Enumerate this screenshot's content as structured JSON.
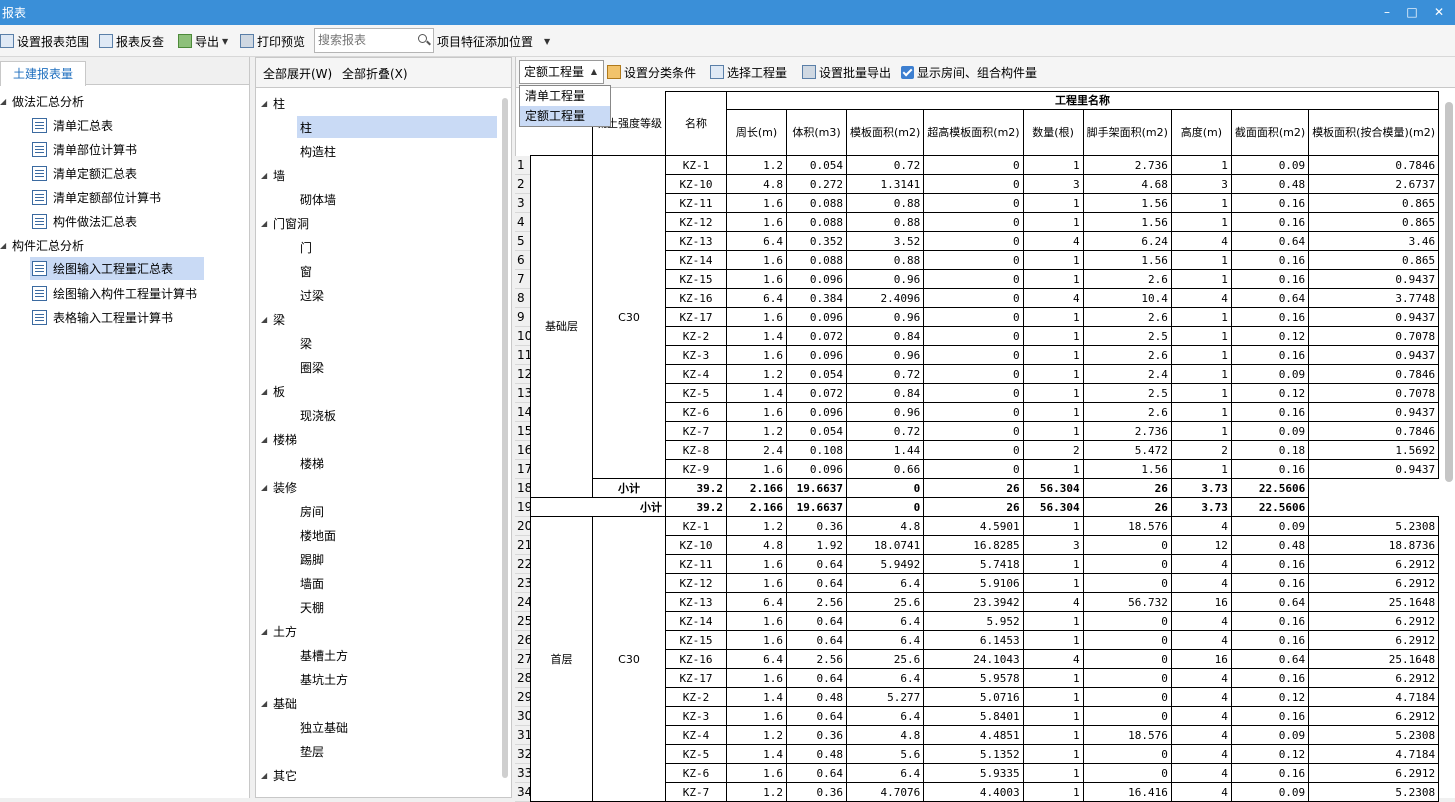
{
  "window": {
    "title": "报表",
    "min": "–",
    "max": "□",
    "close": "✕"
  },
  "toolbar": {
    "set_range": "设置报表范围",
    "reverse": "报表反查",
    "export": "导出",
    "print": "打印预览",
    "search_placeholder": "搜索报表",
    "feature": "项目特征添加位置"
  },
  "left": {
    "tab": "土建报表量",
    "groups": [
      {
        "label": "做法汇总分析",
        "items": [
          "清单汇总表",
          "清单部位计算书",
          "清单定额汇总表",
          "清单定额部位计算书",
          "构件做法汇总表"
        ]
      },
      {
        "label": "构件汇总分析",
        "items": [
          "绘图输入工程量汇总表",
          "绘图输入构件工程量计算书",
          "表格输入工程量计算书"
        ]
      }
    ]
  },
  "mid": {
    "expand": "全部展开(W)",
    "collapse": "全部折叠(X)",
    "tree": [
      {
        "label": "柱",
        "items": [
          "柱",
          "构造柱"
        ]
      },
      {
        "label": "墙",
        "items": [
          "砌体墙"
        ]
      },
      {
        "label": "门窗洞",
        "items": [
          "门",
          "窗",
          "过梁"
        ]
      },
      {
        "label": "梁",
        "items": [
          "梁",
          "圈梁"
        ]
      },
      {
        "label": "板",
        "items": [
          "现浇板"
        ]
      },
      {
        "label": "楼梯",
        "items": [
          "楼梯"
        ]
      },
      {
        "label": "装修",
        "items": [
          "房间",
          "楼地面",
          "踢脚",
          "墙面",
          "天棚"
        ]
      },
      {
        "label": "土方",
        "items": [
          "基槽土方",
          "基坑土方"
        ]
      },
      {
        "label": "基础",
        "items": [
          "独立基础",
          "垫层"
        ]
      },
      {
        "label": "其它",
        "items": []
      }
    ]
  },
  "right": {
    "combo": "定额工程量",
    "opt1": "清单工程量",
    "opt2": "定额工程量",
    "set_cond": "设置分类条件",
    "sel_qty": "选择工程量",
    "batch": "设置批量导出",
    "show": "显示房间、组合构件量"
  },
  "table": {
    "group_header": "工程里名称",
    "h_grade": "凝土强度等级",
    "h_name": "名称",
    "cols": [
      "周长(m)",
      "体积(m3)",
      "模板面积(m2)",
      "超高模板面积(m2)",
      "数量(根)",
      "脚手架面积(m2)",
      "高度(m)",
      "截面面积(m2)",
      "模板面积(按合模量)(m2)"
    ],
    "floor1": "基础层",
    "floor2": "首层",
    "grade": "C30",
    "subtotal": "小计",
    "rows": [
      [
        "KZ-1",
        "1.2",
        "0.054",
        "0.72",
        "0",
        "1",
        "2.736",
        "1",
        "0.09",
        "0.7846"
      ],
      [
        "KZ-10",
        "4.8",
        "0.272",
        "1.3141",
        "0",
        "3",
        "4.68",
        "3",
        "0.48",
        "2.6737"
      ],
      [
        "KZ-11",
        "1.6",
        "0.088",
        "0.88",
        "0",
        "1",
        "1.56",
        "1",
        "0.16",
        "0.865"
      ],
      [
        "KZ-12",
        "1.6",
        "0.088",
        "0.88",
        "0",
        "1",
        "1.56",
        "1",
        "0.16",
        "0.865"
      ],
      [
        "KZ-13",
        "6.4",
        "0.352",
        "3.52",
        "0",
        "4",
        "6.24",
        "4",
        "0.64",
        "3.46"
      ],
      [
        "KZ-14",
        "1.6",
        "0.088",
        "0.88",
        "0",
        "1",
        "1.56",
        "1",
        "0.16",
        "0.865"
      ],
      [
        "KZ-15",
        "1.6",
        "0.096",
        "0.96",
        "0",
        "1",
        "2.6",
        "1",
        "0.16",
        "0.9437"
      ],
      [
        "KZ-16",
        "6.4",
        "0.384",
        "2.4096",
        "0",
        "4",
        "10.4",
        "4",
        "0.64",
        "3.7748"
      ],
      [
        "KZ-17",
        "1.6",
        "0.096",
        "0.96",
        "0",
        "1",
        "2.6",
        "1",
        "0.16",
        "0.9437"
      ],
      [
        "KZ-2",
        "1.4",
        "0.072",
        "0.84",
        "0",
        "1",
        "2.5",
        "1",
        "0.12",
        "0.7078"
      ],
      [
        "KZ-3",
        "1.6",
        "0.096",
        "0.96",
        "0",
        "1",
        "2.6",
        "1",
        "0.16",
        "0.9437"
      ],
      [
        "KZ-4",
        "1.2",
        "0.054",
        "0.72",
        "0",
        "1",
        "2.4",
        "1",
        "0.09",
        "0.7846"
      ],
      [
        "KZ-5",
        "1.4",
        "0.072",
        "0.84",
        "0",
        "1",
        "2.5",
        "1",
        "0.12",
        "0.7078"
      ],
      [
        "KZ-6",
        "1.6",
        "0.096",
        "0.96",
        "0",
        "1",
        "2.6",
        "1",
        "0.16",
        "0.9437"
      ],
      [
        "KZ-7",
        "1.2",
        "0.054",
        "0.72",
        "0",
        "1",
        "2.736",
        "1",
        "0.09",
        "0.7846"
      ],
      [
        "KZ-8",
        "2.4",
        "0.108",
        "1.44",
        "0",
        "2",
        "5.472",
        "2",
        "0.18",
        "1.5692"
      ],
      [
        "KZ-9",
        "1.6",
        "0.096",
        "0.66",
        "0",
        "1",
        "1.56",
        "1",
        "0.16",
        "0.9437"
      ]
    ],
    "sub1": [
      "39.2",
      "2.166",
      "19.6637",
      "0",
      "26",
      "56.304",
      "26",
      "3.73",
      "22.5606"
    ],
    "sub2": [
      "39.2",
      "2.166",
      "19.6637",
      "0",
      "26",
      "56.304",
      "26",
      "3.73",
      "22.5606"
    ],
    "rows2": [
      [
        "KZ-1",
        "1.2",
        "0.36",
        "4.8",
        "4.5901",
        "1",
        "18.576",
        "4",
        "0.09",
        "5.2308"
      ],
      [
        "KZ-10",
        "4.8",
        "1.92",
        "18.0741",
        "16.8285",
        "3",
        "0",
        "12",
        "0.48",
        "18.8736"
      ],
      [
        "KZ-11",
        "1.6",
        "0.64",
        "5.9492",
        "5.7418",
        "1",
        "0",
        "4",
        "0.16",
        "6.2912"
      ],
      [
        "KZ-12",
        "1.6",
        "0.64",
        "6.4",
        "5.9106",
        "1",
        "0",
        "4",
        "0.16",
        "6.2912"
      ],
      [
        "KZ-13",
        "6.4",
        "2.56",
        "25.6",
        "23.3942",
        "4",
        "56.732",
        "16",
        "0.64",
        "25.1648"
      ],
      [
        "KZ-14",
        "1.6",
        "0.64",
        "6.4",
        "5.952",
        "1",
        "0",
        "4",
        "0.16",
        "6.2912"
      ],
      [
        "KZ-15",
        "1.6",
        "0.64",
        "6.4",
        "6.1453",
        "1",
        "0",
        "4",
        "0.16",
        "6.2912"
      ],
      [
        "KZ-16",
        "6.4",
        "2.56",
        "25.6",
        "24.1043",
        "4",
        "0",
        "16",
        "0.64",
        "25.1648"
      ],
      [
        "KZ-17",
        "1.6",
        "0.64",
        "6.4",
        "5.9578",
        "1",
        "0",
        "4",
        "0.16",
        "6.2912"
      ],
      [
        "KZ-2",
        "1.4",
        "0.48",
        "5.277",
        "5.0716",
        "1",
        "0",
        "4",
        "0.12",
        "4.7184"
      ],
      [
        "KZ-3",
        "1.6",
        "0.64",
        "6.4",
        "5.8401",
        "1",
        "0",
        "4",
        "0.16",
        "6.2912"
      ],
      [
        "KZ-4",
        "1.2",
        "0.36",
        "4.8",
        "4.4851",
        "1",
        "18.576",
        "4",
        "0.09",
        "5.2308"
      ],
      [
        "KZ-5",
        "1.4",
        "0.48",
        "5.6",
        "5.1352",
        "1",
        "0",
        "4",
        "0.12",
        "4.7184"
      ],
      [
        "KZ-6",
        "1.6",
        "0.64",
        "6.4",
        "5.9335",
        "1",
        "0",
        "4",
        "0.16",
        "6.2912"
      ],
      [
        "KZ-7",
        "1.2",
        "0.36",
        "4.7076",
        "4.4003",
        "1",
        "16.416",
        "4",
        "0.09",
        "5.2308"
      ]
    ]
  }
}
